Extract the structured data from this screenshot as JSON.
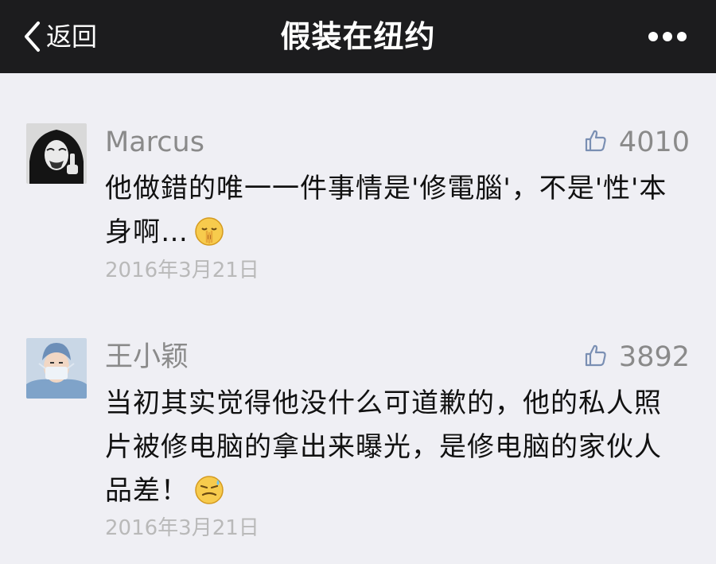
{
  "nav": {
    "back_label": "返回",
    "title": "假装在纽约",
    "back_icon": "chevron-left-icon",
    "more_icon": "ellipsis-icon"
  },
  "colors": {
    "navbar_bg": "#1c1c1e",
    "page_bg": "#efeff4",
    "name_text": "#8a8a8a",
    "like_icon": "#7a8fb3",
    "date_text": "#b9b9b9"
  },
  "comments": [
    {
      "author": "Marcus",
      "likes": "4010",
      "text": "他做錯的唯一一件事情是'修電腦'，不是'性'本身啊…",
      "emoji": "shushing-face-emoji",
      "date": "2016年3月21日"
    },
    {
      "author": "王小颖",
      "likes": "3892",
      "text": "当初其实觉得他没什么可道歉的，他的私人照片被修电脑的拿出来曝光，是修电脑的家伙人品差！",
      "emoji": "sweat-smile-face-emoji",
      "date": "2016年3月21日"
    }
  ]
}
